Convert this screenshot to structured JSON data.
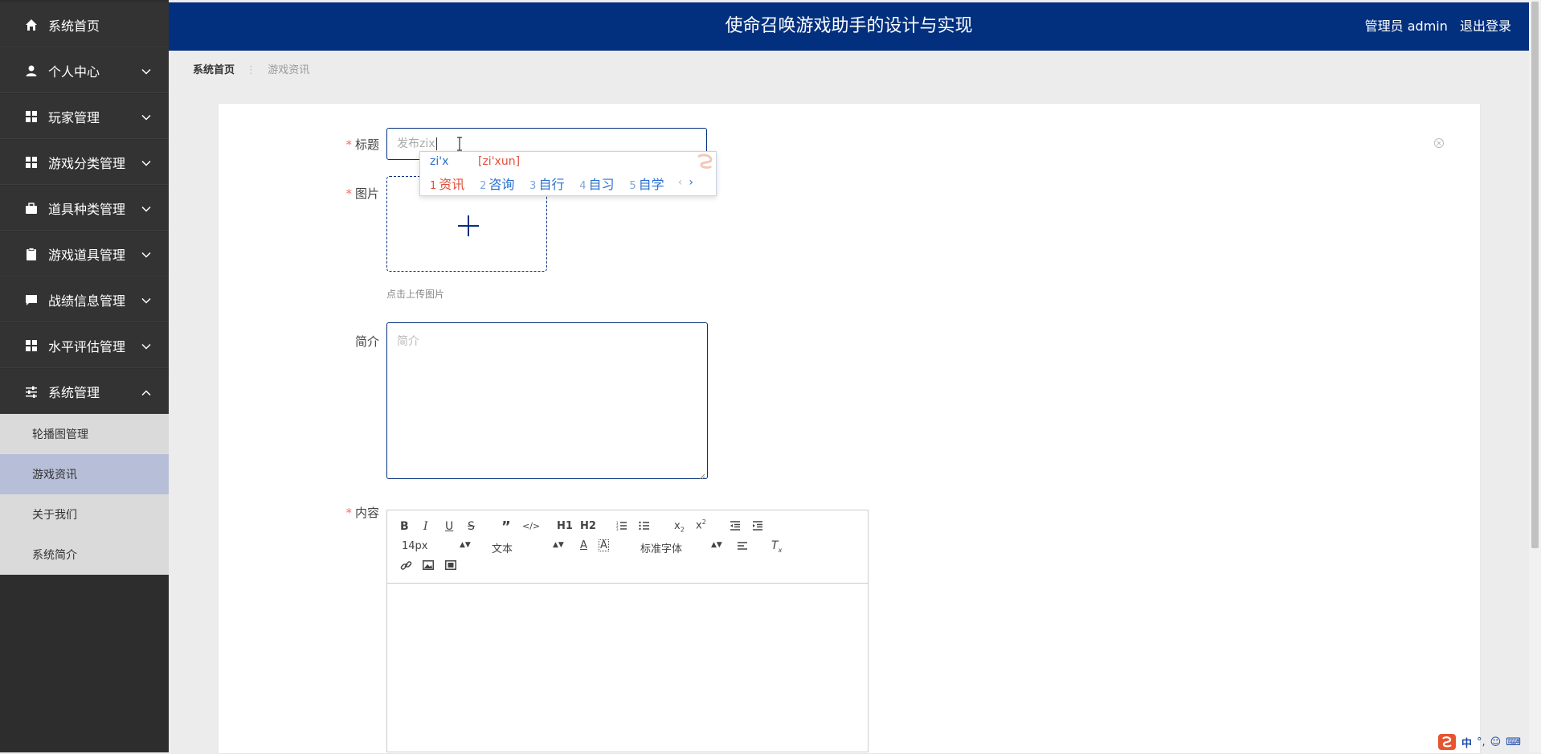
{
  "sidebar": {
    "items": [
      {
        "label": "系统首页",
        "icon": "home-icon",
        "expandable": false
      },
      {
        "label": "个人中心",
        "icon": "user-icon",
        "expandable": true
      },
      {
        "label": "玩家管理",
        "icon": "grid-icon",
        "expandable": true
      },
      {
        "label": "游戏分类管理",
        "icon": "grid-icon",
        "expandable": true
      },
      {
        "label": "道具种类管理",
        "icon": "briefcase-icon",
        "expandable": true
      },
      {
        "label": "游戏道具管理",
        "icon": "clipboard-icon",
        "expandable": true
      },
      {
        "label": "战绩信息管理",
        "icon": "chat-icon",
        "expandable": true
      },
      {
        "label": "水平评估管理",
        "icon": "grid-icon",
        "expandable": true
      },
      {
        "label": "系统管理",
        "icon": "sliders-icon",
        "expandable": true,
        "expanded": true
      }
    ],
    "submenu": [
      {
        "label": "轮播图管理"
      },
      {
        "label": "游戏资讯",
        "active": true
      },
      {
        "label": "关于我们"
      },
      {
        "label": "系统简介"
      }
    ]
  },
  "header": {
    "title": "使命召唤游戏助手的设计与实现",
    "user": "管理员 admin",
    "logout": "退出登录",
    "color": "#03307e"
  },
  "breadcrumb": {
    "home": "系统首页",
    "current": "游戏资讯"
  },
  "form": {
    "title_label": "标题",
    "title_value": "发布zix",
    "image_label": "图片",
    "upload_tip": "点击上传图片",
    "intro_label": "简介",
    "intro_placeholder": "简介",
    "content_label": "内容"
  },
  "ime": {
    "pinyin": "zi'x",
    "pinyin_full": "[zi'xun]",
    "candidates": [
      {
        "n": "1",
        "text": "资讯"
      },
      {
        "n": "2",
        "text": "咨询"
      },
      {
        "n": "3",
        "text": "自行"
      },
      {
        "n": "4",
        "text": "自习"
      },
      {
        "n": "5",
        "text": "自学"
      }
    ]
  },
  "editor": {
    "font_size": "14px",
    "heading": "文本",
    "font_family": "标准字体",
    "h1": "H1",
    "h2": "H2"
  },
  "tray": {
    "lang": "中"
  }
}
